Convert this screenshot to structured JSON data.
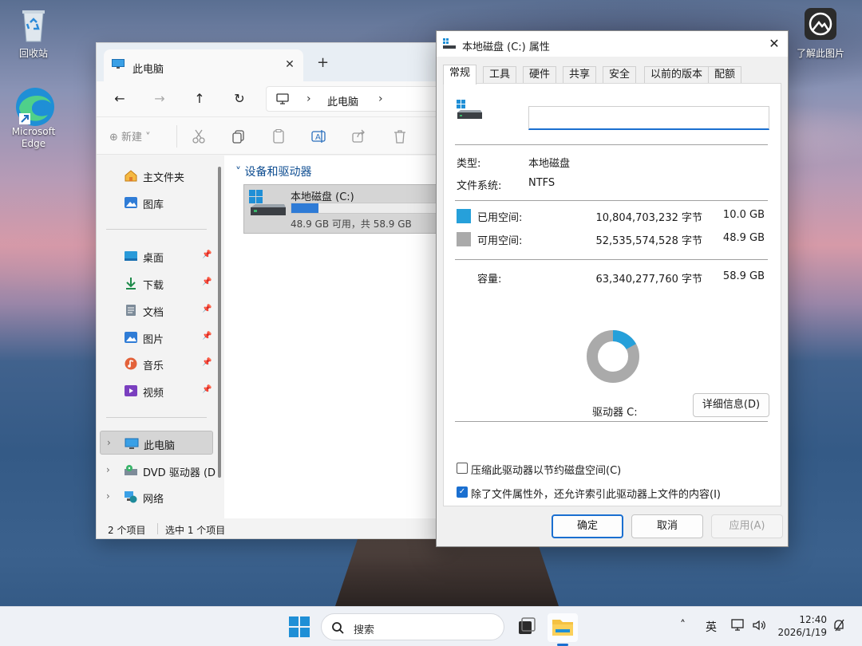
{
  "desktop": {
    "icons": [
      {
        "label": "回收站",
        "icon": "recycle-bin-icon"
      },
      {
        "label": "Microsoft Edge",
        "icon": "edge-icon"
      },
      {
        "label": "了解此图片",
        "icon": "learn-about-picture-icon"
      }
    ]
  },
  "explorer": {
    "tab_title": "此电脑",
    "address": "此电脑",
    "toolbar": {
      "new_label": "新建"
    },
    "nav": {
      "home": "主文件夹",
      "gallery": "图库",
      "pinned": [
        {
          "label": "桌面",
          "icon": "desktop-icon"
        },
        {
          "label": "下载",
          "icon": "download-icon"
        },
        {
          "label": "文档",
          "icon": "documents-icon"
        },
        {
          "label": "图片",
          "icon": "pictures-icon"
        },
        {
          "label": "音乐",
          "icon": "music-icon"
        },
        {
          "label": "视频",
          "icon": "videos-icon"
        }
      ],
      "this_pc": "此电脑",
      "dvd": "DVD 驱动器 (D",
      "network": "网络"
    },
    "group_header": "设备和驱动器",
    "drive": {
      "name": "本地磁盘 (C:)",
      "summary": "48.9 GB 可用，共 58.9 GB",
      "used_fraction": 0.17
    },
    "status": {
      "count": "2 个项目",
      "selected": "选中 1 个项目"
    }
  },
  "properties": {
    "title": "本地磁盘 (C:) 属性",
    "tabs": [
      "常规",
      "工具",
      "硬件",
      "共享",
      "安全",
      "以前的版本",
      "配额"
    ],
    "active_tab": "常规",
    "volume_label_value": "",
    "type_label": "类型:",
    "type_value": "本地磁盘",
    "fs_label": "文件系统:",
    "fs_value": "NTFS",
    "used": {
      "label": "已用空间:",
      "bytes": "10,804,703,232 字节",
      "gb": "10.0 GB",
      "color": "#26a0da"
    },
    "free": {
      "label": "可用空间:",
      "bytes": "52,535,574,528 字节",
      "gb": "48.9 GB",
      "color": "#aaaaaa"
    },
    "capacity": {
      "label": "容量:",
      "bytes": "63,340,277,760 字节",
      "gb": "58.9 GB"
    },
    "used_fraction": 0.17,
    "drive_label": "驱动器 C:",
    "details_button": "详细信息(D)",
    "compress_checkbox": {
      "label": "压缩此驱动器以节约磁盘空间(C)",
      "checked": false
    },
    "index_checkbox": {
      "label": "除了文件属性外，还允许索引此驱动器上文件的内容(I)",
      "checked": true
    },
    "buttons": {
      "ok": "确定",
      "cancel": "取消",
      "apply": "应用(A)"
    }
  },
  "taskbar": {
    "search_placeholder": "搜索",
    "ime": "英",
    "time": "12:40",
    "date": "2026/1/19"
  }
}
